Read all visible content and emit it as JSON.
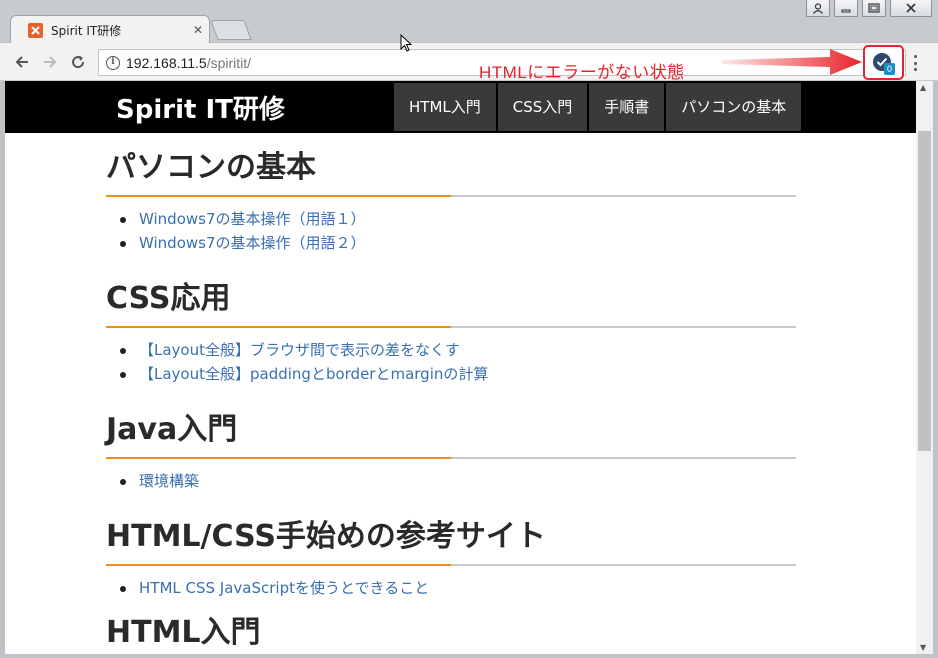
{
  "browser": {
    "tab_title": "Spirit IT研修",
    "url_host": "192.168.11.5",
    "url_path": "/spiritit/"
  },
  "annotation": {
    "text": "HTMLにエラーがない状態",
    "color": "#e8222a"
  },
  "extension": {
    "badge": "0"
  },
  "site": {
    "title": "Spirit IT研修",
    "nav": [
      "HTML入門",
      "CSS入門",
      "手順書",
      "パソコンの基本"
    ]
  },
  "sections": [
    {
      "heading": "パソコンの基本",
      "links": [
        "Windows7の基本操作（用語１）",
        "Windows7の基本操作（用語２）"
      ]
    },
    {
      "heading": "CSS応用",
      "links": [
        "【Layout全般】ブラウザ間で表示の差をなくす",
        "【Layout全般】paddingとborderとmarginの計算"
      ]
    },
    {
      "heading": "Java入門",
      "links": [
        "環境構築"
      ]
    },
    {
      "heading": "HTML/CSS手始めの参考サイト",
      "links": [
        "HTML CSS JavaScriptを使うとできること"
      ]
    },
    {
      "heading": "HTML入門",
      "links": []
    }
  ],
  "colors": {
    "accent_orange": "#f08c1a",
    "link_blue": "#3a6fb0",
    "header_black": "#000000"
  }
}
